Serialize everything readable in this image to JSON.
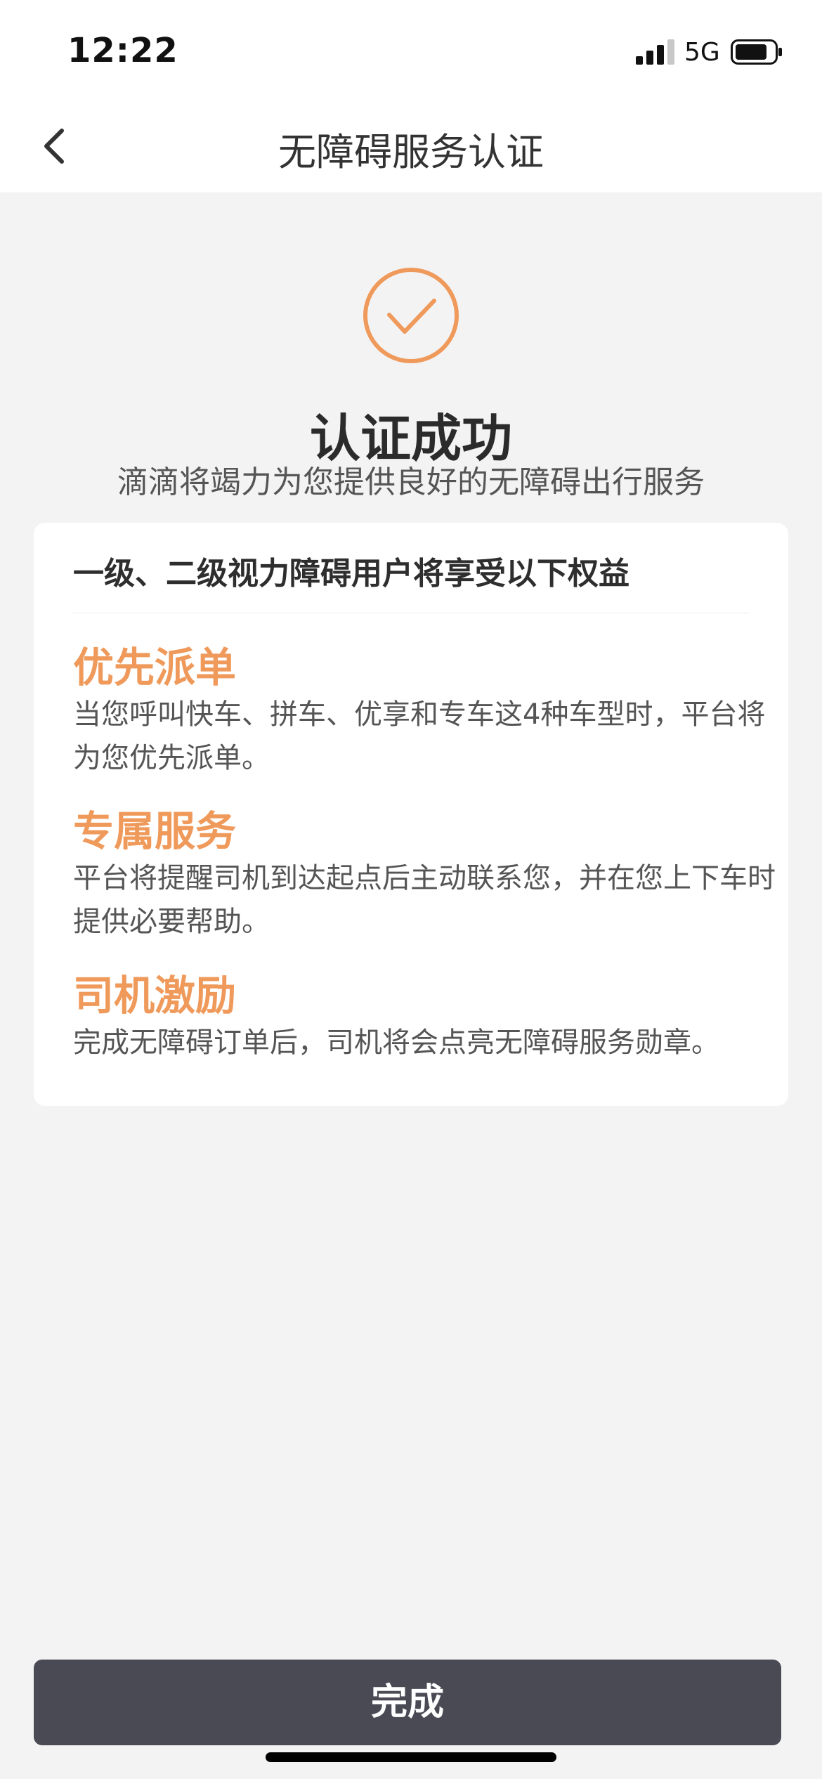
{
  "status_bar": {
    "time": "12:22",
    "network": "5G",
    "icons": [
      "signal-icon",
      "battery-icon"
    ]
  },
  "nav": {
    "back_icon": "chevron-left-icon",
    "title": "无障碍服务认证"
  },
  "result": {
    "icon": "check-circle-icon",
    "icon_color": "#ef9a5b",
    "title": "认证成功",
    "subtitle": "滴滴将竭力为您提供良好的无障碍出行服务"
  },
  "card": {
    "heading": "一级、二级视力障碍用户将享受以下权益",
    "benefits": [
      {
        "title": "优先派单",
        "desc": "当您呼叫快车、拼车、优享和专车这4种车型时，平台将为您优先派单。"
      },
      {
        "title": "专属服务",
        "desc": "平台将提醒司机到达起点后主动联系您，并在您上下车时提供必要帮助。"
      },
      {
        "title": "司机激励",
        "desc": "完成无障碍订单后，司机将会点亮无障碍服务勋章。"
      }
    ]
  },
  "footer": {
    "done_label": "完成",
    "button_color": "#4a4a55"
  },
  "colors": {
    "accent": "#ef9a5b",
    "background": "#f3f3f4"
  }
}
